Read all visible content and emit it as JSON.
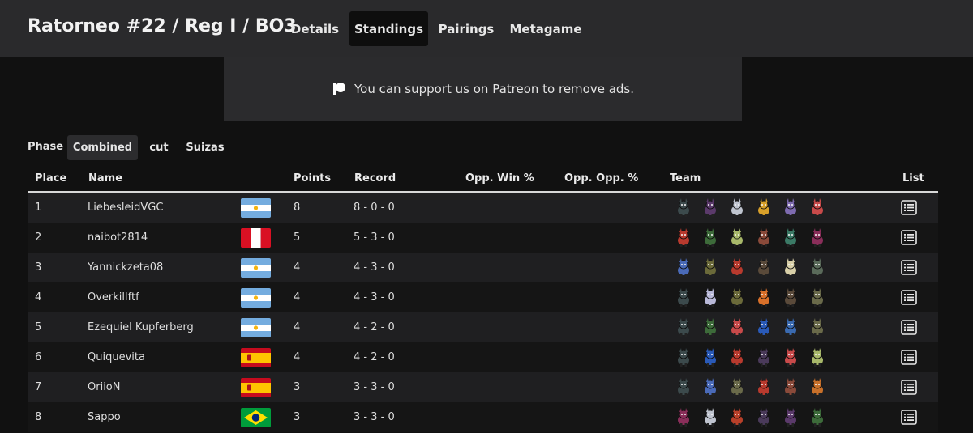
{
  "app": {
    "title": "Ratorneo #22 / Reg I / BO3",
    "tabs": [
      {
        "label": "Details",
        "active": false
      },
      {
        "label": "Standings",
        "active": true
      },
      {
        "label": "Pairings",
        "active": false
      },
      {
        "label": "Metagame",
        "active": false
      }
    ]
  },
  "ad": {
    "icon": "patreon-icon",
    "text": "You can support us on Patreon to remove ads."
  },
  "phase": {
    "label": "Phase",
    "options": [
      {
        "label": "Combined",
        "active": true
      },
      {
        "label": "cut",
        "active": false
      },
      {
        "label": "Suizas",
        "active": false
      }
    ]
  },
  "table": {
    "columns": [
      "Place",
      "Name",
      "Points",
      "Record",
      "Opp. Win %",
      "Opp. Opp. %",
      "Team",
      "List"
    ],
    "rows": [
      {
        "place": "1",
        "name": "LiebesleidVGC",
        "flag": "argentina",
        "points": "8",
        "record": "8 - 0 - 0",
        "opp_win": "",
        "opp_opp": "",
        "team": [
          {
            "name": "zamazenta-like-sprite",
            "color": "#3c4a4c"
          },
          {
            "name": "dark-purple-sprite",
            "color": "#5b3a6b"
          },
          {
            "name": "white-grey-sprite",
            "color": "#bfc4cf"
          },
          {
            "name": "yellow-sprite",
            "color": "#d8a02a"
          },
          {
            "name": "purple-yellow-sprite",
            "color": "#7e6bb0"
          },
          {
            "name": "amoonguss-like-sprite",
            "color": "#c84a4a"
          }
        ]
      },
      {
        "place": "2",
        "name": "naibot2814",
        "flag": "peru",
        "points": "5",
        "record": "5 - 3 - 0",
        "opp_win": "",
        "opp_opp": "",
        "team": [
          {
            "name": "incineroar-like-sprite",
            "color": "#b83a2e"
          },
          {
            "name": "rillaboom-like-sprite",
            "color": "#3d6b3a"
          },
          {
            "name": "pale-green-sprite",
            "color": "#a8b86a"
          },
          {
            "name": "brown-red-sprite",
            "color": "#8a4a3a"
          },
          {
            "name": "teal-green-sprite",
            "color": "#3b7a66"
          },
          {
            "name": "magenta-dark-sprite",
            "color": "#8a2e5a"
          }
        ]
      },
      {
        "place": "3",
        "name": "Yannickzeta08",
        "flag": "argentina",
        "points": "4",
        "record": "4 - 3 - 0",
        "opp_win": "",
        "opp_opp": "",
        "team": [
          {
            "name": "blue-white-sprite",
            "color": "#4a6ab8"
          },
          {
            "name": "olive-dark-sprite",
            "color": "#6b6a3a"
          },
          {
            "name": "incineroar-like-sprite",
            "color": "#b83a2e"
          },
          {
            "name": "ursaluna-like-sprite",
            "color": "#5a4a3a"
          },
          {
            "name": "cream-sprite",
            "color": "#d8cfa8"
          },
          {
            "name": "grey-green-sprite",
            "color": "#5a6a5a"
          }
        ]
      },
      {
        "place": "4",
        "name": "Overkillftf",
        "flag": "argentina",
        "points": "4",
        "record": "4 - 3 - 0",
        "opp_win": "",
        "opp_opp": "",
        "team": [
          {
            "name": "zamazenta-like-sprite",
            "color": "#3c4a4c"
          },
          {
            "name": "white-purple-sprite",
            "color": "#b8b8d8"
          },
          {
            "name": "olive-dark-sprite",
            "color": "#6b6a3a"
          },
          {
            "name": "orange-sprite",
            "color": "#d8702a"
          },
          {
            "name": "ursaluna-like-sprite",
            "color": "#5a4a3a"
          },
          {
            "name": "grey-yellow-sprite",
            "color": "#6a6a4a"
          }
        ]
      },
      {
        "place": "5",
        "name": "Ezequiel Kupferberg",
        "flag": "argentina",
        "points": "4",
        "record": "4 - 2 - 0",
        "opp_win": "",
        "opp_opp": "",
        "team": [
          {
            "name": "zamazenta-like-sprite",
            "color": "#3c4a4c"
          },
          {
            "name": "rillaboom-like-sprite",
            "color": "#3d6b3a"
          },
          {
            "name": "amoonguss-like-sprite",
            "color": "#c84a4a"
          },
          {
            "name": "kyogre-like-sprite",
            "color": "#2a5ab8"
          },
          {
            "name": "blue-winged-sprite",
            "color": "#3a6ab0"
          },
          {
            "name": "grey-yellow-sprite",
            "color": "#6a6a4a"
          }
        ]
      },
      {
        "place": "6",
        "name": "Quiquevita",
        "flag": "spain",
        "points": "4",
        "record": "4 - 2 - 0",
        "opp_win": "",
        "opp_opp": "",
        "team": [
          {
            "name": "zamazenta-like-sprite",
            "color": "#3c4a4c"
          },
          {
            "name": "kyogre-like-sprite",
            "color": "#2a5ab8"
          },
          {
            "name": "incineroar-like-sprite",
            "color": "#b83a2e"
          },
          {
            "name": "dark-bat-sprite",
            "color": "#4a3a5a"
          },
          {
            "name": "amoonguss-like-sprite",
            "color": "#c84a4a"
          },
          {
            "name": "pale-green-sprite",
            "color": "#a8b86a"
          }
        ]
      },
      {
        "place": "7",
        "name": "OriioN",
        "flag": "spain",
        "points": "3",
        "record": "3 - 3 - 0",
        "opp_win": "",
        "opp_opp": "",
        "team": [
          {
            "name": "zamazenta-like-sprite",
            "color": "#3c4a4c"
          },
          {
            "name": "blue-white-sprite",
            "color": "#4a6ab8"
          },
          {
            "name": "grey-yellow-sprite",
            "color": "#6a6a4a"
          },
          {
            "name": "incineroar-like-sprite",
            "color": "#b83a2e"
          },
          {
            "name": "brown-red-sprite",
            "color": "#8a4a3a"
          },
          {
            "name": "orange-deer-sprite",
            "color": "#c8702a"
          }
        ]
      },
      {
        "place": "8",
        "name": "Sappo",
        "flag": "brazil",
        "points": "3",
        "record": "3 - 3 - 0",
        "opp_win": "",
        "opp_opp": "",
        "team": [
          {
            "name": "magenta-dark-sprite",
            "color": "#8a2e5a"
          },
          {
            "name": "white-grey-sprite",
            "color": "#bfc4cf"
          },
          {
            "name": "red-bird-sprite",
            "color": "#b8402a"
          },
          {
            "name": "dark-bat-sprite",
            "color": "#4a3a5a"
          },
          {
            "name": "dark-purple-sprite",
            "color": "#5b3a6b"
          },
          {
            "name": "rillaboom-like-sprite",
            "color": "#3d6b3a"
          }
        ]
      }
    ]
  },
  "colors": {
    "topbar": "#2a2a2c",
    "background": "#111111",
    "row_odd": "#1f1f21",
    "row_even": "#151515",
    "active_tab": "#0e0e0e"
  }
}
